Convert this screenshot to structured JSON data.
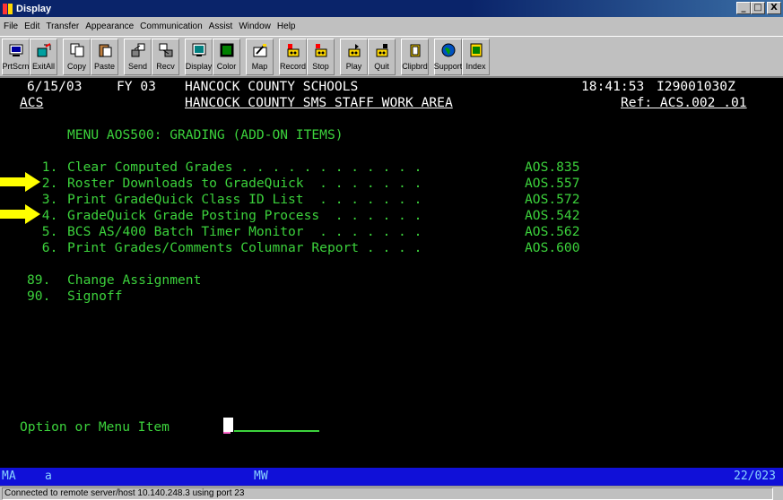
{
  "window": {
    "title": "Display",
    "minimize": "_",
    "maximize": "□",
    "close": "X"
  },
  "menubar": [
    "File",
    "Edit",
    "Transfer",
    "Appearance",
    "Communication",
    "Assist",
    "Window",
    "Help"
  ],
  "toolbar": [
    {
      "label": "PrtScrn",
      "icon": "printer-screen-icon"
    },
    {
      "label": "ExitAll",
      "icon": "exit-all-icon"
    },
    {
      "label": "Copy",
      "icon": "copy-icon"
    },
    {
      "label": "Paste",
      "icon": "paste-icon"
    },
    {
      "label": "Send",
      "icon": "send-icon"
    },
    {
      "label": "Recv",
      "icon": "receive-icon"
    },
    {
      "label": "Display",
      "icon": "display-icon"
    },
    {
      "label": "Color",
      "icon": "color-icon"
    },
    {
      "label": "Map",
      "icon": "map-icon"
    },
    {
      "label": "Record",
      "icon": "record-icon"
    },
    {
      "label": "Stop",
      "icon": "stop-icon"
    },
    {
      "label": "Play",
      "icon": "play-icon"
    },
    {
      "label": "Quit",
      "icon": "quit-icon"
    },
    {
      "label": "Clipbrd",
      "icon": "clipboard-icon"
    },
    {
      "label": "Support",
      "icon": "support-globe-icon"
    },
    {
      "label": "Index",
      "icon": "index-book-icon"
    }
  ],
  "terminal": {
    "header": {
      "date": "6/15/03",
      "fy": "FY 03",
      "title": "HANCOCK COUNTY SCHOOLS",
      "time": "18:41:53",
      "session_id": "I29001030Z",
      "app": "ACS",
      "subtitle": "HANCOCK COUNTY SMS STAFF WORK AREA",
      "ref": "Ref: ACS.002 .01"
    },
    "menu_title": "MENU AOS500: GRADING (ADD-ON ITEMS)",
    "items": [
      {
        "num": " 1.",
        "text": "Clear Computed Grades . . . . . . . . . . . .",
        "code": "AOS.835"
      },
      {
        "num": " 2.",
        "text": "Roster Downloads to GradeQuick  . . . . . . .",
        "code": "AOS.557"
      },
      {
        "num": " 3.",
        "text": "Print GradeQuick Class ID List  . . . . . . .",
        "code": "AOS.572"
      },
      {
        "num": " 4.",
        "text": "GradeQuick Grade Posting Process  . . . . . .",
        "code": "AOS.542"
      },
      {
        "num": " 5.",
        "text": "BCS AS/400 Batch Timer Monitor  . . . . . . .",
        "code": "AOS.562"
      },
      {
        "num": " 6.",
        "text": "Print Grades/Comments Columnar Report . . . .",
        "code": "AOS.600"
      }
    ],
    "extra_items": [
      {
        "num": "89.",
        "text": "Change Assignment"
      },
      {
        "num": "90.",
        "text": "Signoff"
      }
    ],
    "prompt": "Option or Menu Item",
    "input_value": ""
  },
  "statusline": {
    "left": "MA",
    "mode": "a",
    "mw": "MW",
    "position": "22/023"
  },
  "statusbar": {
    "message": "Connected to remote server/host 10.140.248.3 using port 23"
  },
  "colors": {
    "terminal_green": "#3cd23c",
    "terminal_white": "#ffffff",
    "status_blue": "#1010d8",
    "arrow_yellow": "#ffff00"
  }
}
